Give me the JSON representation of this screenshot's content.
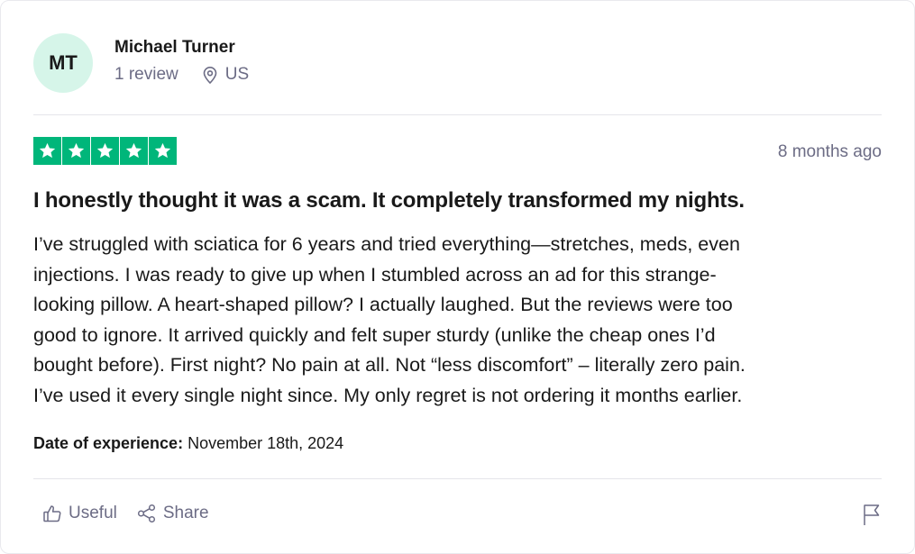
{
  "reviewer": {
    "initials": "MT",
    "name": "Michael Turner",
    "review_count": "1 review",
    "location": "US"
  },
  "review": {
    "rating": 5,
    "rating_max": 5,
    "date_ago": "8 months ago",
    "title": "I honestly thought it was a scam. It completely transformed my nights.",
    "body_lines": [
      "I’ve struggled with sciatica for 6 years and tried everything—stretches, meds, even",
      "injections. I was ready to give up when I stumbled across an ad for this strange-",
      "looking pillow. A heart-shaped pillow? I actually laughed. But the reviews were too",
      "good to ignore. It arrived quickly and felt super sturdy (unlike the cheap ones I’d",
      "bought before). First night? No pain at all. Not “less discomfort” – literally zero pain.",
      "I’ve used it every single night since. My only regret is not ordering it months earlier."
    ],
    "experience_label": "Date of experience:",
    "experience_date": "November 18th, 2024"
  },
  "actions": {
    "useful_label": "Useful",
    "share_label": "Share"
  },
  "icons": {
    "location": "location-pin-icon",
    "star": "star-icon",
    "useful": "thumbs-up-icon",
    "share": "share-icon",
    "flag": "flag-icon"
  },
  "colors": {
    "star_green": "#00b67a",
    "avatar_bg": "#d6f5e9",
    "muted_text": "#6c6c85",
    "divider": "#e5e5ea"
  }
}
